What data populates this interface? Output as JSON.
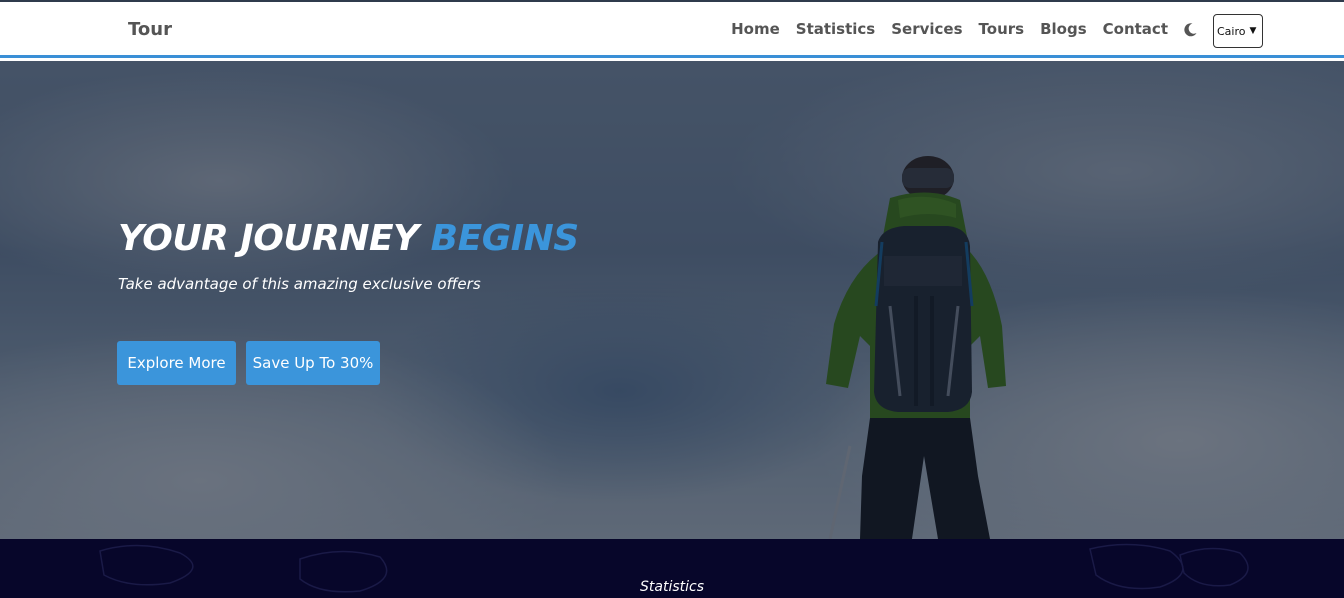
{
  "navbar": {
    "brand": "Tour",
    "links": [
      "Home",
      "Statistics",
      "Services",
      "Tours",
      "Blogs",
      "Contact"
    ],
    "theme_icon": "moon-icon",
    "city_select": {
      "value": "Cairo"
    }
  },
  "hero": {
    "title_main": "YOUR JOURNEY ",
    "title_accent": "BEGINS",
    "subtitle": "Take advantage of this amazing exclusive offers",
    "buttons": {
      "explore": "Explore More",
      "save": "Save Up To 30%"
    }
  },
  "stats": {
    "title": "Statistics"
  },
  "colors": {
    "accent": "#3b95db",
    "stats_bg": "#07062a",
    "nav_text": "#555555"
  }
}
